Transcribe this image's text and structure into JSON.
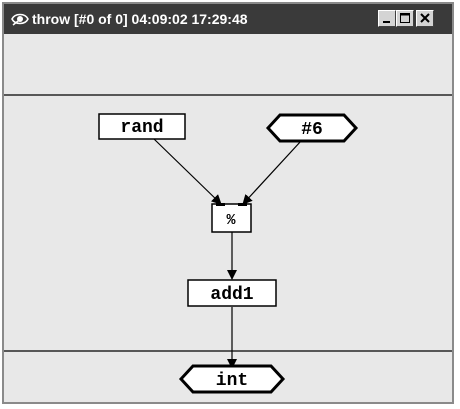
{
  "window": {
    "title": "throw [#0 of 0]  04:09:02 17:29:48"
  },
  "graph": {
    "nodes": {
      "rand": "rand",
      "const": "#6",
      "mod": "%",
      "add": "add1",
      "out": "int"
    }
  },
  "colors": {
    "titlebar": "#3a3a3a",
    "canvas": "#e8e8e8",
    "node_fill": "#ffffff",
    "lines": "#000000"
  }
}
